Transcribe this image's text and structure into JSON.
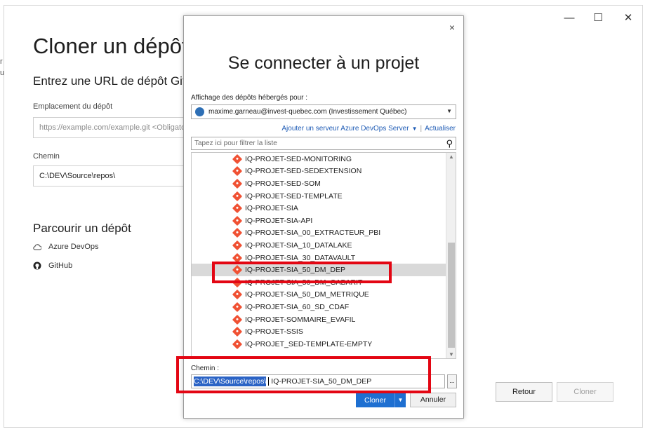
{
  "background_window": {
    "title": "Cloner un dépôt",
    "subtitle": "Entrez une URL de dépôt Git",
    "repo_location_label": "Emplacement du dépôt",
    "repo_location_placeholder": "https://example.com/example.git <Obligatoire>",
    "path_label": "Chemin",
    "path_value": "C:\\DEV\\Source\\repos\\",
    "browse_title": "Parcourir un dépôt",
    "browse_links": [
      {
        "label": "Azure DevOps",
        "icon": "cloud-icon"
      },
      {
        "label": "GitHub",
        "icon": "github-icon"
      }
    ],
    "back_button": "Retour",
    "clone_button": "Cloner",
    "window_controls": {
      "minimize": "—",
      "maximize": "☐",
      "close": "✕"
    },
    "left_edge_chars": "r\nu"
  },
  "dialog": {
    "close": "×",
    "title": "Se connecter à un projet",
    "host_label": "Affichage des dépôts hébergés pour :",
    "account": "maxime.garneau@invest-quebec.com (Investissement Québec)",
    "add_server_link": "Ajouter un serveur Azure DevOps Server",
    "refresh_link": "Actualiser",
    "filter_placeholder": "Tapez ici pour filtrer la liste",
    "repos": [
      "IQ-PROJET-SED-MONITORING",
      "IQ-PROJET-SED-SEDEXTENSION",
      "IQ-PROJET-SED-SOM",
      "IQ-PROJET-SED-TEMPLATE",
      "IQ-PROJET-SIA",
      "IQ-PROJET-SIA-API",
      "IQ-PROJET-SIA_00_EXTRACTEUR_PBI",
      "IQ-PROJET-SIA_10_DATALAKE",
      "IQ-PROJET-SIA_30_DATAVAULT",
      "IQ-PROJET-SIA_50_DM_DEP",
      "IQ-PROJET-SIA_50_DM_GABARIT",
      "IQ-PROJET-SIA_50_DM_METRIQUE",
      "IQ-PROJET-SIA_60_SD_CDAF",
      "IQ-PROJET-SOMMAIRE_EVAFIL",
      "IQ-PROJET-SSIS",
      "IQ-PROJET_SED-TEMPLATE-EMPTY"
    ],
    "selected_repo": "IQ-PROJET-SIA_50_DM_DEP",
    "path_label": "Chemin :",
    "path_selected_part": "C:\\DEV\\Source\\repos\\",
    "path_rest": "IQ-PROJET-SIA_50_DM_DEP",
    "browse_button": "...",
    "clone_button": "Cloner",
    "cancel_button": "Annuler"
  }
}
